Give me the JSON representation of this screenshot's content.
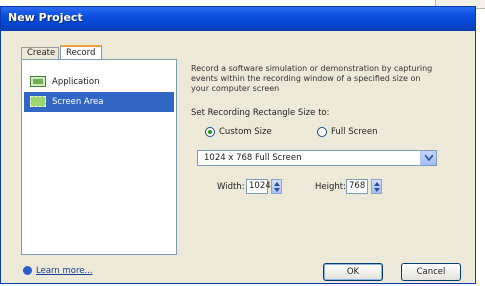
{
  "window": {
    "title": "New Project"
  },
  "tabs": [
    {
      "label": "Create",
      "active": false
    },
    {
      "label": "Record",
      "active": true
    }
  ],
  "list": {
    "items": [
      {
        "label": "Application",
        "icon": "application-icon",
        "selected": false
      },
      {
        "label": "Screen Area",
        "icon": "screen-area-icon",
        "selected": true
      }
    ]
  },
  "details": {
    "description": "Record a software simulation or demonstration by capturing events within the recording window of a specified size on your computer screen",
    "section_label": "Set Recording Rectangle Size to:",
    "radios": [
      {
        "label": "Custom Size",
        "checked": true
      },
      {
        "label": "Full Screen",
        "checked": false
      }
    ],
    "size_select": {
      "value": "1024 x 768 Full Screen"
    },
    "width_label": "Width:",
    "width_value": "1024",
    "height_label": "Height:",
    "height_value": "768"
  },
  "footer": {
    "learn_more": "Learn more...",
    "ok_label": "OK",
    "cancel_label": "Cancel"
  },
  "colors": {
    "titlebar": "#0646d2",
    "selection": "#3166c5",
    "dialog_bg": "#ece9d8"
  }
}
